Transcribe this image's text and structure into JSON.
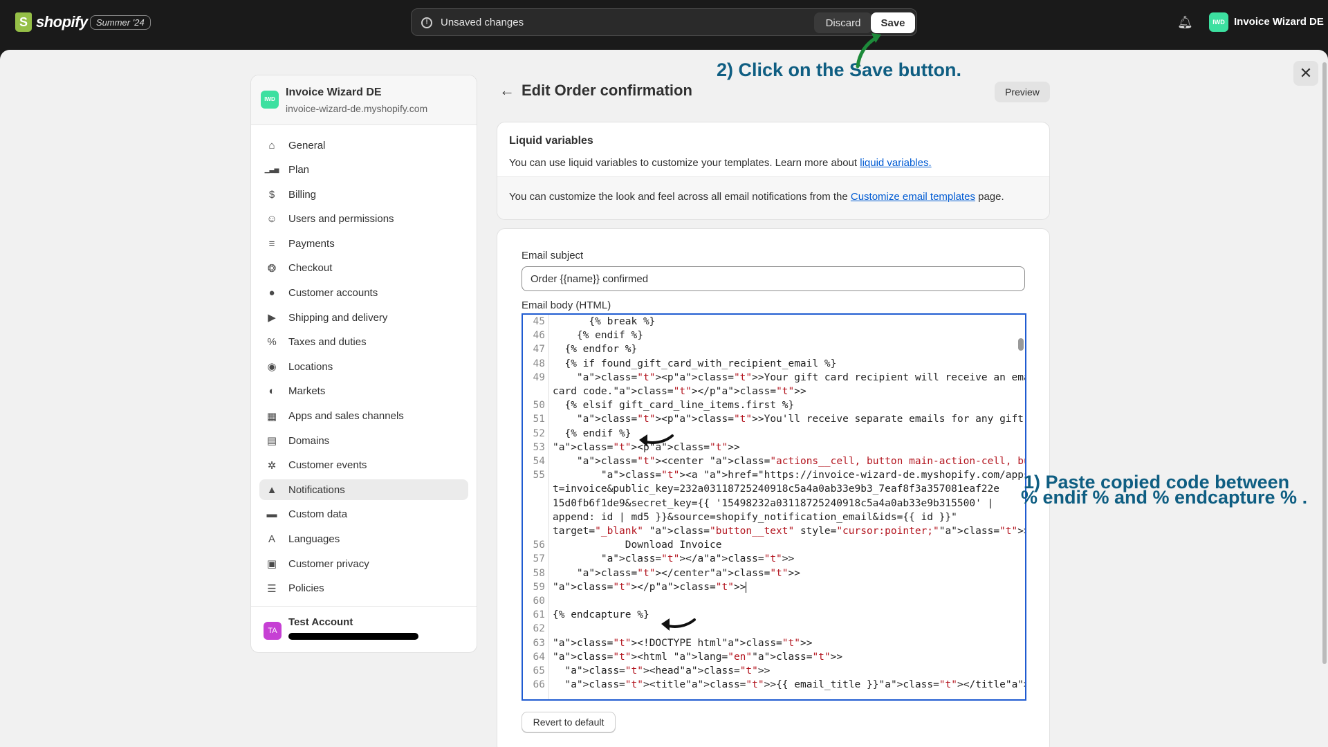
{
  "topbar": {
    "brand": "shopify",
    "edition": "Summer '24",
    "unsaved_text": "Unsaved changes",
    "discard_label": "Discard",
    "save_label": "Save",
    "store_badge": "IWD",
    "store_name": "Invoice Wizard DE"
  },
  "sidebar": {
    "store_badge": "IWD",
    "store_name": "Invoice Wizard DE",
    "store_domain": "invoice-wizard-de.myshopify.com",
    "items": [
      {
        "label": "General",
        "icon": "store-icon"
      },
      {
        "label": "Plan",
        "icon": "chart-icon"
      },
      {
        "label": "Billing",
        "icon": "billing-icon"
      },
      {
        "label": "Users and permissions",
        "icon": "users-icon"
      },
      {
        "label": "Payments",
        "icon": "payments-icon"
      },
      {
        "label": "Checkout",
        "icon": "cart-icon"
      },
      {
        "label": "Customer accounts",
        "icon": "person-icon"
      },
      {
        "label": "Shipping and delivery",
        "icon": "truck-icon"
      },
      {
        "label": "Taxes and duties",
        "icon": "tax-icon"
      },
      {
        "label": "Locations",
        "icon": "location-icon"
      },
      {
        "label": "Markets",
        "icon": "globe-icon"
      },
      {
        "label": "Apps and sales channels",
        "icon": "apps-icon"
      },
      {
        "label": "Domains",
        "icon": "domain-icon"
      },
      {
        "label": "Customer events",
        "icon": "cursor-icon"
      },
      {
        "label": "Notifications",
        "icon": "bell-icon"
      },
      {
        "label": "Custom data",
        "icon": "database-icon"
      },
      {
        "label": "Languages",
        "icon": "language-icon"
      },
      {
        "label": "Customer privacy",
        "icon": "lock-icon"
      },
      {
        "label": "Policies",
        "icon": "policy-icon"
      }
    ],
    "active_item": "Notifications",
    "account_badge": "TA",
    "account_name": "Test Account"
  },
  "page": {
    "title": "Edit Order confirmation",
    "preview_label": "Preview"
  },
  "liquid_card": {
    "title": "Liquid variables",
    "text": "You can use liquid variables to customize your templates. Learn more about ",
    "link": "liquid variables.",
    "text2": "You can customize the look and feel across all email notifications from the ",
    "link2": "Customize email templates",
    "text2_end": " page."
  },
  "email": {
    "subject_label": "Email subject",
    "subject_value": "Order {{name}} confirmed",
    "body_label": "Email body (HTML)",
    "revert_label": "Revert to default",
    "code_lines": [
      {
        "n": "45",
        "text": "      {% break %}"
      },
      {
        "n": "46",
        "text": "    {% endif %}"
      },
      {
        "n": "47",
        "text": "  {% endfor %}"
      },
      {
        "n": "48",
        "text": "  {% if found_gift_card_with_recipient_email %}"
      },
      {
        "n": "49",
        "text": "    <p>Your gift card recipient will receive an email with their gift"
      },
      {
        "n": "",
        "text": "card code.</p>"
      },
      {
        "n": "50",
        "text": "  {% elsif gift_card_line_items.first %}"
      },
      {
        "n": "51",
        "text": "    <p>You'll receive separate emails for any gift cards.</p>"
      },
      {
        "n": "52",
        "text": "  {% endif %}"
      },
      {
        "n": "53",
        "text": "<p>"
      },
      {
        "n": "54",
        "text": "    <center class=\"actions__cell, button main-action-cell, button__cell\">"
      },
      {
        "n": "55",
        "text": "        <a href=\"https://invoice-wizard-de.myshopify.com/apps/download?"
      },
      {
        "n": "",
        "text": "t=invoice&public_key=232a03118725240918c5a4a0ab33e9b3_7eaf8f3a357081eaf22e"
      },
      {
        "n": "",
        "text": "15d0fb6f1de9&secret_key={{ '15498232a03118725240918c5a4a0ab33e9b315500' |"
      },
      {
        "n": "",
        "text": "append: id | md5 }}&source=shopify_notification_email&ids={{ id }}\""
      },
      {
        "n": "",
        "text": "target=\"_blank\" class=\"button__text\" style=\"cursor:pointer;\">"
      },
      {
        "n": "56",
        "text": "            Download Invoice"
      },
      {
        "n": "57",
        "text": "        </a>"
      },
      {
        "n": "58",
        "text": "    </center>"
      },
      {
        "n": "59",
        "text": "</p>"
      },
      {
        "n": "60",
        "text": ""
      },
      {
        "n": "61",
        "text": "{% endcapture %}"
      },
      {
        "n": "62",
        "text": ""
      },
      {
        "n": "63",
        "text": "<!DOCTYPE html>"
      },
      {
        "n": "64",
        "text": "<html lang=\"en\">"
      },
      {
        "n": "65",
        "text": "  <head>"
      },
      {
        "n": "66",
        "text": "  <title>{{ email_title }}</title>"
      }
    ]
  },
  "annotations": {
    "step2": "2) Click on the Save button.",
    "step1_line1": "1) Paste copied code between",
    "step1_line2": "% endif % and % endcapture % ."
  },
  "colors": {
    "topbar_bg": "#1a1a1a",
    "surface_bg": "#f1f1f1",
    "link": "#005bd3",
    "editor_border": "#1f5bd1",
    "annotation": "#0f5e82",
    "store_badge": "#3ce0a0",
    "account_badge": "#c640d4"
  }
}
